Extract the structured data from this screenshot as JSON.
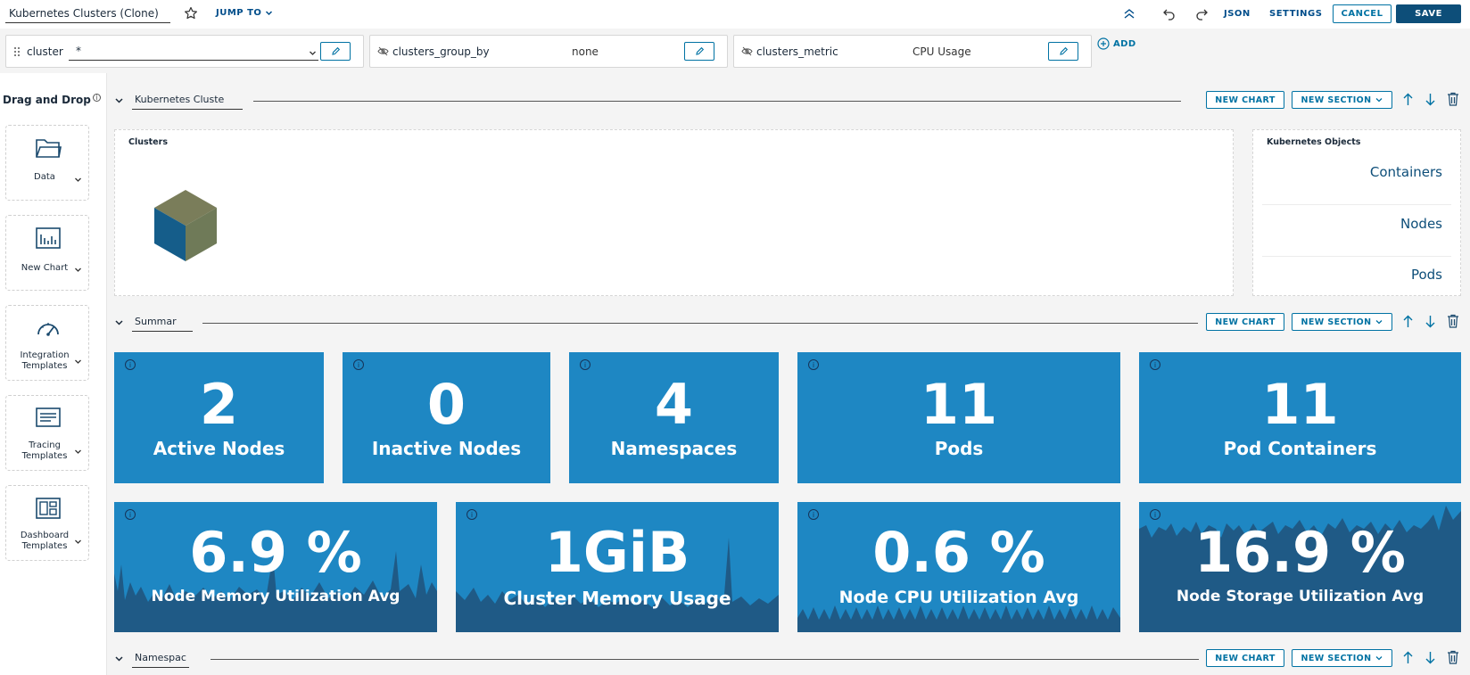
{
  "topbar": {
    "title_value": "Kubernetes Clusters (Clone)",
    "jump_to_label": "JUMP TO",
    "json_label": "JSON",
    "settings_label": "SETTINGS",
    "cancel_label": "CANCEL",
    "save_label": "SAVE"
  },
  "variables": [
    {
      "name": "cluster",
      "value": "*"
    },
    {
      "name": "clusters_group_by",
      "value": "none"
    },
    {
      "name": "clusters_metric",
      "value": "CPU Usage"
    }
  ],
  "add_label": "ADD",
  "sidebar": {
    "title": "Drag and Drop",
    "items": [
      {
        "label": "Data",
        "icon": "folder-icon"
      },
      {
        "label": "New Chart",
        "icon": "bar-chart-icon"
      },
      {
        "label": "Integration Templates",
        "icon": "speedometer-icon"
      },
      {
        "label": "Tracing Templates",
        "icon": "document-lines-icon"
      },
      {
        "label": "Dashboard Templates",
        "icon": "dashboard-grid-icon"
      }
    ]
  },
  "sections": [
    {
      "name": "Kubernetes Cluste"
    },
    {
      "name": "Summar"
    },
    {
      "name": "Namespac"
    }
  ],
  "section_buttons": {
    "new_chart": "NEW CHART",
    "new_section": "NEW SECTION"
  },
  "clusters_panel": {
    "title": "Clusters"
  },
  "k8s_objects_panel": {
    "title": "Kubernetes Objects",
    "links": [
      "Containers",
      "Nodes",
      "Pods"
    ]
  },
  "stats_row1": [
    {
      "value": "2",
      "label": "Active Nodes"
    },
    {
      "value": "0",
      "label": "Inactive Nodes"
    },
    {
      "value": "4",
      "label": "Namespaces"
    },
    {
      "value": "11",
      "label": "Pods"
    },
    {
      "value": "11",
      "label": "Pod Containers"
    }
  ],
  "stats_row2": [
    {
      "value": "6.9 %",
      "label": "Node Memory Utilization Avg"
    },
    {
      "value": "1GiB",
      "label": "Cluster Memory Usage"
    },
    {
      "value": "0.6 %",
      "label": "Node CPU Utilization Avg"
    },
    {
      "value": "16.9 %",
      "label": "Node Storage Utilization Avg"
    }
  ],
  "colors": {
    "tile_blue": "#1e87c3",
    "spark_dark": "#1f5a86",
    "primary": "#0072a3",
    "save": "#0d4e79"
  }
}
